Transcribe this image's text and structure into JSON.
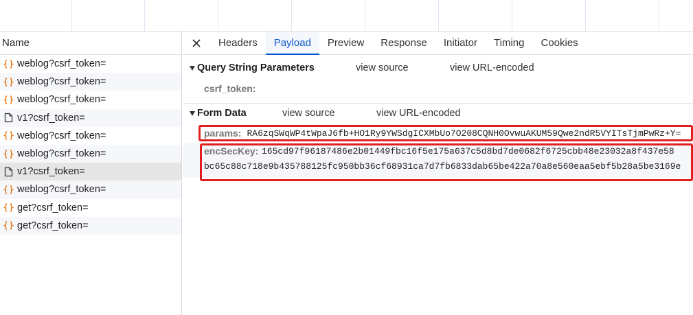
{
  "request_list": {
    "header": "Name",
    "items": [
      {
        "name": "weblog?csrf_token=",
        "icon": "xhr-braces-icon",
        "selected": false
      },
      {
        "name": "weblog?csrf_token=",
        "icon": "xhr-braces-icon",
        "selected": false
      },
      {
        "name": "weblog?csrf_token=",
        "icon": "xhr-braces-icon",
        "selected": false
      },
      {
        "name": "v1?csrf_token=",
        "icon": "document-icon",
        "selected": false
      },
      {
        "name": "weblog?csrf_token=",
        "icon": "xhr-braces-icon",
        "selected": false
      },
      {
        "name": "weblog?csrf_token=",
        "icon": "xhr-braces-icon",
        "selected": false
      },
      {
        "name": "v1?csrf_token=",
        "icon": "document-icon",
        "selected": true
      },
      {
        "name": "weblog?csrf_token=",
        "icon": "xhr-braces-icon",
        "selected": false
      },
      {
        "name": "get?csrf_token=",
        "icon": "xhr-braces-icon",
        "selected": false
      },
      {
        "name": "get?csrf_token=",
        "icon": "xhr-braces-icon",
        "selected": false
      }
    ]
  },
  "tabs": [
    {
      "label": "Headers",
      "active": false
    },
    {
      "label": "Payload",
      "active": true
    },
    {
      "label": "Preview",
      "active": false
    },
    {
      "label": "Response",
      "active": false
    },
    {
      "label": "Initiator",
      "active": false
    },
    {
      "label": "Timing",
      "active": false
    },
    {
      "label": "Cookies",
      "active": false
    }
  ],
  "query_string": {
    "title": "Query String Parameters",
    "view_source": "view source",
    "view_url_encoded": "view URL-encoded",
    "param_key": "csrf_token:",
    "param_value": ""
  },
  "form_data": {
    "title": "Form Data",
    "view_source": "view source",
    "view_url_encoded": "view URL-encoded",
    "params_key": "params:",
    "params_value": "RA6zqSWqWP4tWpaJ6fb+HO1Ry9YWSdgICXMbUo7O208CQNH0OvwuAKUM59Qwe2ndR5VYITsTjmPwRz+Y=",
    "encseckey_key": "encSecKey:",
    "encseckey_line1": "165cd97f96187486e2b01449fbc16f5e175a637c5d8bd7de0682f6725cbb48e23032a8f437e58",
    "encseckey_line2": "bc65c88c718e9b435788125fc950bb36cf68931ca7d7fb6833dab65be422a70a8e560eaa5ebf5b28a5be3169e"
  },
  "colors": {
    "accent": "#0b57d0",
    "highlight_box": "#e02020",
    "xhr_icon": "#e8710a",
    "selected_row": "#e6e6e6"
  }
}
